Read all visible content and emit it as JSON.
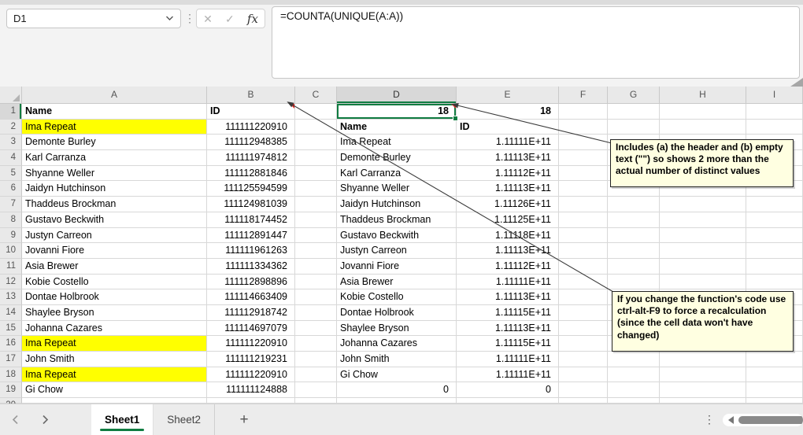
{
  "formula_bar": {
    "name_box_value": "D1",
    "formula": "=COUNTA(UNIQUE(A:A))",
    "fx_label": "fx",
    "cancel_icon": "✕",
    "enter_icon": "✓",
    "separator_icon": "⋮"
  },
  "grid": {
    "column_headers": [
      "A",
      "B",
      "C",
      "D",
      "E",
      "F",
      "G",
      "H",
      "I"
    ],
    "selected_cell": "D1",
    "selected_column": "D",
    "selected_row": "1",
    "comment_flags": [
      "B1",
      "D1"
    ],
    "rows": [
      {
        "num": "1",
        "cells": {
          "A": [
            "Name",
            "b"
          ],
          "B": [
            "ID",
            "b"
          ],
          "D": [
            "18",
            "b n"
          ],
          "E": [
            "18",
            "b n"
          ]
        }
      },
      {
        "num": "2",
        "cells": {
          "A": [
            "Ima Repeat",
            "hl"
          ],
          "B": [
            "111111220910",
            "n"
          ],
          "D": [
            "Name",
            "b"
          ],
          "E": [
            "ID",
            "b"
          ]
        }
      },
      {
        "num": "3",
        "cells": {
          "A": [
            "Demonte Burley",
            ""
          ],
          "B": [
            "111112948385",
            "n"
          ],
          "D": [
            "Ima Repeat",
            ""
          ],
          "E": [
            "1.11111E+11",
            "n"
          ]
        }
      },
      {
        "num": "4",
        "cells": {
          "A": [
            "Karl Carranza",
            ""
          ],
          "B": [
            "111111974812",
            "n"
          ],
          "D": [
            "Demonte Burley",
            ""
          ],
          "E": [
            "1.11113E+11",
            "n"
          ]
        }
      },
      {
        "num": "5",
        "cells": {
          "A": [
            "Shyanne Weller",
            ""
          ],
          "B": [
            "111112881846",
            "n"
          ],
          "D": [
            "Karl Carranza",
            ""
          ],
          "E": [
            "1.11112E+11",
            "n"
          ]
        }
      },
      {
        "num": "6",
        "cells": {
          "A": [
            "Jaidyn Hutchinson",
            ""
          ],
          "B": [
            "111125594599",
            "n"
          ],
          "D": [
            "Shyanne Weller",
            ""
          ],
          "E": [
            "1.11113E+11",
            "n"
          ]
        }
      },
      {
        "num": "7",
        "cells": {
          "A": [
            "Thaddeus Brockman",
            ""
          ],
          "B": [
            "111124981039",
            "n"
          ],
          "D": [
            "Jaidyn Hutchinson",
            ""
          ],
          "E": [
            "1.11126E+11",
            "n"
          ]
        }
      },
      {
        "num": "8",
        "cells": {
          "A": [
            "Gustavo Beckwith",
            ""
          ],
          "B": [
            "111118174452",
            "n"
          ],
          "D": [
            "Thaddeus Brockman",
            ""
          ],
          "E": [
            "1.11125E+11",
            "n"
          ]
        }
      },
      {
        "num": "9",
        "cells": {
          "A": [
            "Justyn Carreon",
            ""
          ],
          "B": [
            "111112891447",
            "n"
          ],
          "D": [
            "Gustavo Beckwith",
            ""
          ],
          "E": [
            "1.11118E+11",
            "n"
          ]
        }
      },
      {
        "num": "10",
        "cells": {
          "A": [
            "Jovanni Fiore",
            ""
          ],
          "B": [
            "111111961263",
            "n"
          ],
          "D": [
            "Justyn Carreon",
            ""
          ],
          "E": [
            "1.11113E+11",
            "n"
          ]
        }
      },
      {
        "num": "11",
        "cells": {
          "A": [
            "Asia Brewer",
            ""
          ],
          "B": [
            "111111334362",
            "n"
          ],
          "D": [
            "Jovanni Fiore",
            ""
          ],
          "E": [
            "1.11112E+11",
            "n"
          ]
        }
      },
      {
        "num": "12",
        "cells": {
          "A": [
            "Kobie Costello",
            ""
          ],
          "B": [
            "111112898896",
            "n"
          ],
          "D": [
            "Asia Brewer",
            ""
          ],
          "E": [
            "1.11111E+11",
            "n"
          ]
        }
      },
      {
        "num": "13",
        "cells": {
          "A": [
            "Dontae Holbrook",
            ""
          ],
          "B": [
            "111114663409",
            "n"
          ],
          "D": [
            "Kobie Costello",
            ""
          ],
          "E": [
            "1.11113E+11",
            "n"
          ]
        }
      },
      {
        "num": "14",
        "cells": {
          "A": [
            "Shaylee Bryson",
            ""
          ],
          "B": [
            "111112918742",
            "n"
          ],
          "D": [
            "Dontae Holbrook",
            ""
          ],
          "E": [
            "1.11115E+11",
            "n"
          ]
        }
      },
      {
        "num": "15",
        "cells": {
          "A": [
            "Johanna Cazares",
            ""
          ],
          "B": [
            "111114697079",
            "n"
          ],
          "D": [
            "Shaylee Bryson",
            ""
          ],
          "E": [
            "1.11113E+11",
            "n"
          ]
        }
      },
      {
        "num": "16",
        "cells": {
          "A": [
            "Ima Repeat",
            "hl"
          ],
          "B": [
            "111111220910",
            "n"
          ],
          "D": [
            "Johanna Cazares",
            ""
          ],
          "E": [
            "1.11115E+11",
            "n"
          ]
        }
      },
      {
        "num": "17",
        "cells": {
          "A": [
            "John Smith",
            ""
          ],
          "B": [
            "111111219231",
            "n"
          ],
          "D": [
            "John Smith",
            ""
          ],
          "E": [
            "1.11111E+11",
            "n"
          ]
        }
      },
      {
        "num": "18",
        "cells": {
          "A": [
            "Ima Repeat",
            "hl"
          ],
          "B": [
            "111111220910",
            "n"
          ],
          "D": [
            "Gi Chow",
            ""
          ],
          "E": [
            "1.11111E+11",
            "n"
          ]
        }
      },
      {
        "num": "19",
        "cells": {
          "A": [
            "Gi Chow",
            ""
          ],
          "B": [
            "111111124888",
            "n"
          ],
          "D": [
            "0",
            "n"
          ],
          "E": [
            "0",
            "n"
          ]
        }
      },
      {
        "num": "20",
        "cells": {}
      }
    ]
  },
  "annotations": {
    "note1": "Includes (a) the header and (b) empty text (\"\") so shows 2 more than the actual number of distinct values",
    "note2": "If you change the function's code use ctrl-alt-F9 to force a recalculation (since the cell data won't have changed)"
  },
  "sheet_tabs": {
    "tabs": [
      {
        "label": "Sheet1",
        "active": true
      },
      {
        "label": "Sheet2",
        "active": false
      }
    ],
    "add_label": "+",
    "menu_icon": "⋮"
  },
  "colors": {
    "accent_green": "#107C41",
    "highlight_yellow": "#FFFF00",
    "note_background": "#FFFFE1",
    "comment_flag_red": "#E8251F"
  }
}
